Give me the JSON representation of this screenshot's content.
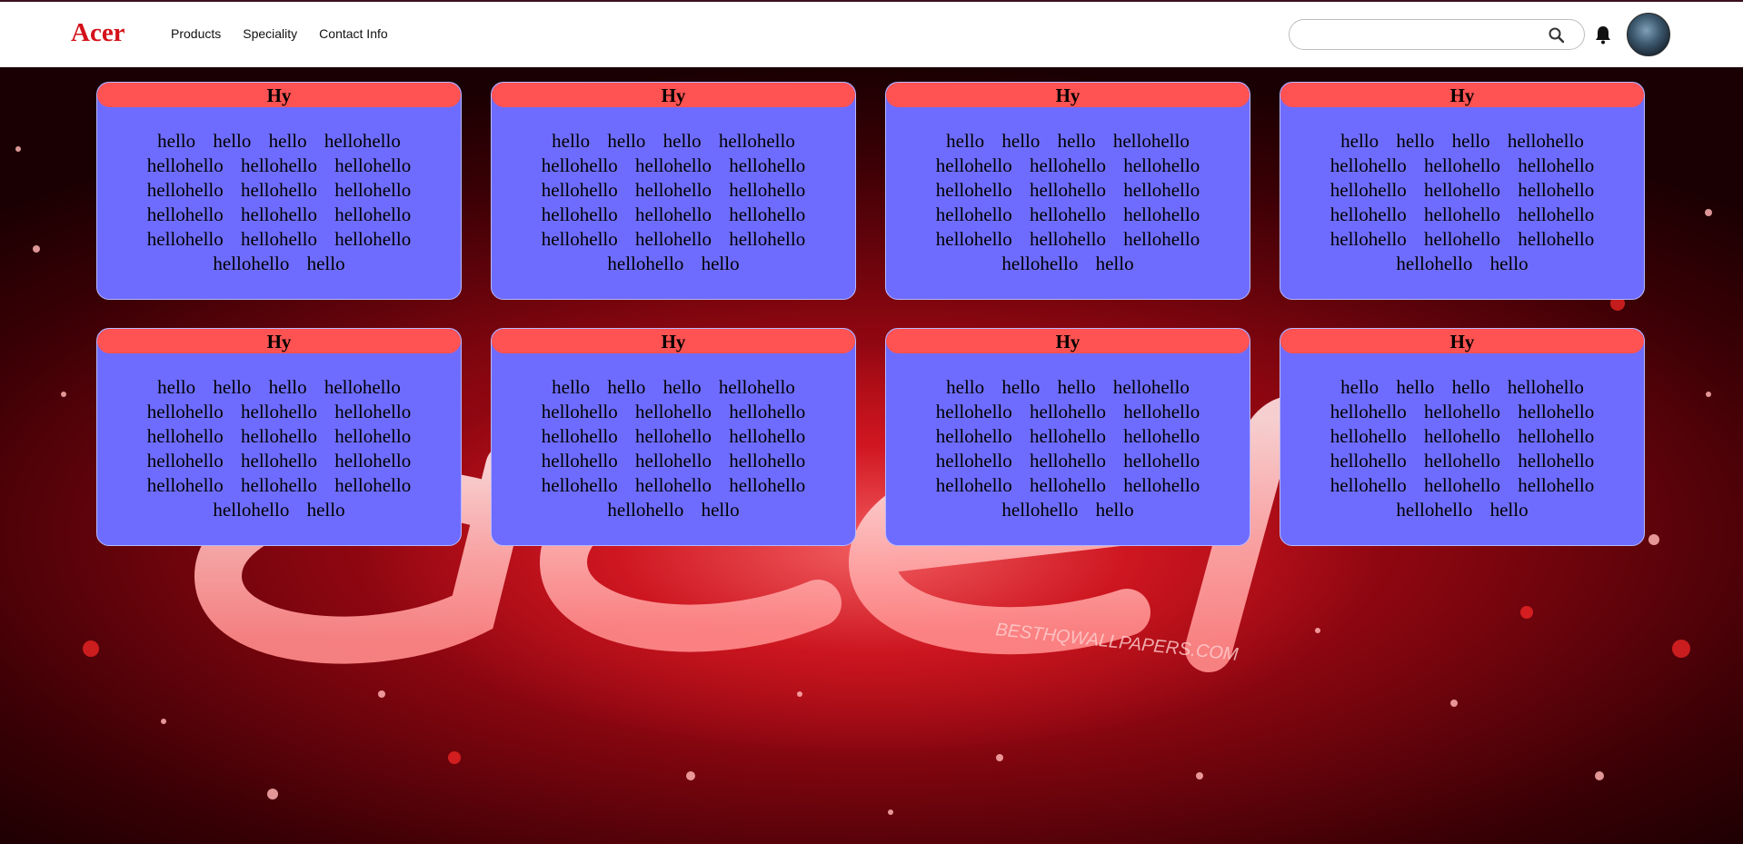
{
  "navbar": {
    "brand": "Acer",
    "links": [
      "Products",
      "Speciality",
      "Contact Info"
    ],
    "search": {
      "value": "",
      "placeholder": ""
    }
  },
  "background": {
    "watermark_text": "BESTHQWALLPAPERS.COM"
  },
  "cards": [
    {
      "title": "Hy",
      "body": "hello hello hello hellohello hellohello hellohello hellohello hellohello hellohello hellohello hellohello hellohello hellohello hellohello hellohello hellohello hellohello hello"
    },
    {
      "title": "Hy",
      "body": "hello hello hello hellohello hellohello hellohello hellohello hellohello hellohello hellohello hellohello hellohello hellohello hellohello hellohello hellohello hellohello hello"
    },
    {
      "title": "Hy",
      "body": "hello hello hello hellohello hellohello hellohello hellohello hellohello hellohello hellohello hellohello hellohello hellohello hellohello hellohello hellohello hellohello hello"
    },
    {
      "title": "Hy",
      "body": "hello hello hello hellohello hellohello hellohello hellohello hellohello hellohello hellohello hellohello hellohello hellohello hellohello hellohello hellohello hellohello hello"
    },
    {
      "title": "Hy",
      "body": "hello hello hello hellohello hellohello hellohello hellohello hellohello hellohello hellohello hellohello hellohello hellohello hellohello hellohello hellohello hellohello hello"
    },
    {
      "title": "Hy",
      "body": "hello hello hello hellohello hellohello hellohello hellohello hellohello hellohello hellohello hellohello hellohello hellohello hellohello hellohello hellohello hellohello hello"
    },
    {
      "title": "Hy",
      "body": "hello hello hello hellohello hellohello hellohello hellohello hellohello hellohello hellohello hellohello hellohello hellohello hellohello hellohello hellohello hellohello hello"
    },
    {
      "title": "Hy",
      "body": "hello hello hello hellohello hellohello hellohello hellohello hellohello hellohello hellohello hellohello hellohello hellohello hellohello hellohello hellohello hellohello hello"
    }
  ],
  "colors": {
    "brand": "#d4121a",
    "card_bg": "#6e6cff",
    "card_header": "#ff5252",
    "background": "#c80d18"
  }
}
